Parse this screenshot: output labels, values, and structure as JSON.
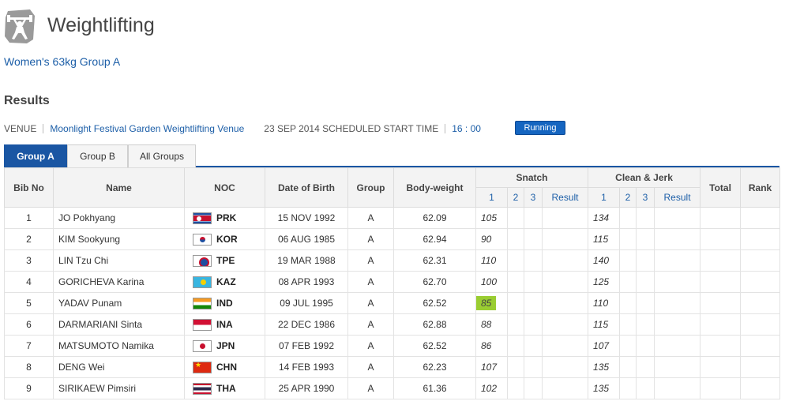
{
  "header": {
    "sport": "Weightlifting",
    "event": "Women's 63kg Group A"
  },
  "results": {
    "title": "Results",
    "venue_label": "VENUE",
    "venue_name": "Moonlight Festival Garden Weightlifting Venue",
    "date_text": "23 SEP 2014 SCHEDULED START TIME",
    "time": "16 : 00",
    "status": "Running"
  },
  "tabs": [
    {
      "label": "Group A",
      "active": true
    },
    {
      "label": "Group B",
      "active": false
    },
    {
      "label": "All Groups",
      "active": false
    }
  ],
  "columns": {
    "bib": "Bib No",
    "name": "Name",
    "noc": "NOC",
    "dob": "Date of Birth",
    "group": "Group",
    "bodyweight": "Body-weight",
    "snatch": "Snatch",
    "cleanjerk": "Clean & Jerk",
    "total": "Total",
    "rank": "Rank",
    "attempt1": "1",
    "attempt2": "2",
    "attempt3": "3",
    "result": "Result"
  },
  "colors": {
    "accent": "#1a56a3",
    "link": "#1d5fa8",
    "highlight": "#9acd32"
  },
  "rows": [
    {
      "bib": "1",
      "name": "JO Pokhyang",
      "noc": "PRK",
      "dob": "15 NOV 1992",
      "group": "A",
      "bw": "62.09",
      "sn1": "105",
      "cj1": "134",
      "highlight": false
    },
    {
      "bib": "2",
      "name": "KIM Sookyung",
      "noc": "KOR",
      "dob": "06 AUG 1985",
      "group": "A",
      "bw": "62.94",
      "sn1": "90",
      "cj1": "115",
      "highlight": false
    },
    {
      "bib": "3",
      "name": "LIN Tzu Chi",
      "noc": "TPE",
      "dob": "19 MAR 1988",
      "group": "A",
      "bw": "62.31",
      "sn1": "110",
      "cj1": "140",
      "highlight": false
    },
    {
      "bib": "4",
      "name": "GORICHEVA Karina",
      "noc": "KAZ",
      "dob": "08 APR 1993",
      "group": "A",
      "bw": "62.70",
      "sn1": "100",
      "cj1": "125",
      "highlight": false
    },
    {
      "bib": "5",
      "name": "YADAV Punam",
      "noc": "IND",
      "dob": "09 JUL 1995",
      "group": "A",
      "bw": "62.52",
      "sn1": "85",
      "cj1": "110",
      "highlight": true
    },
    {
      "bib": "6",
      "name": "DARMARIANI Sinta",
      "noc": "INA",
      "dob": "22 DEC 1986",
      "group": "A",
      "bw": "62.88",
      "sn1": "88",
      "cj1": "115",
      "highlight": false
    },
    {
      "bib": "7",
      "name": "MATSUMOTO Namika",
      "noc": "JPN",
      "dob": "07 FEB 1992",
      "group": "A",
      "bw": "62.52",
      "sn1": "86",
      "cj1": "107",
      "highlight": false
    },
    {
      "bib": "8",
      "name": "DENG Wei",
      "noc": "CHN",
      "dob": "14 FEB 1993",
      "group": "A",
      "bw": "62.23",
      "sn1": "107",
      "cj1": "135",
      "highlight": false
    },
    {
      "bib": "9",
      "name": "SIRIKAEW Pimsiri",
      "noc": "THA",
      "dob": "25 APR 1990",
      "group": "A",
      "bw": "61.36",
      "sn1": "102",
      "cj1": "135",
      "highlight": false
    }
  ]
}
